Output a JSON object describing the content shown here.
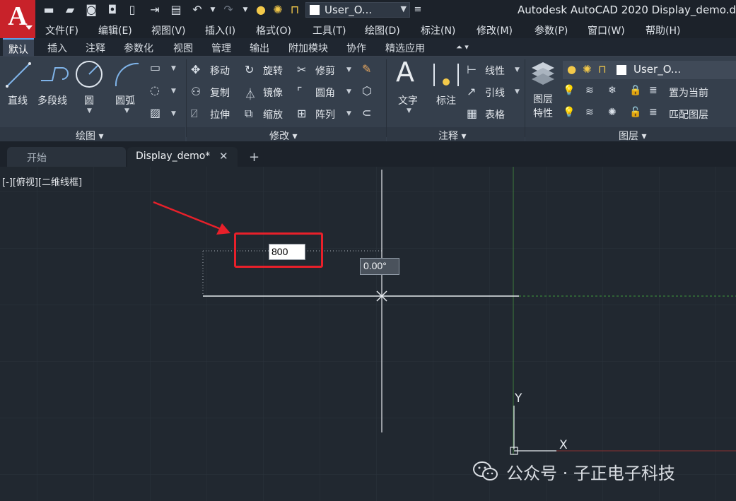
{
  "title": "Autodesk AutoCAD 2020    Display_demo.d",
  "quick_access": {
    "layer_name": "User_O..."
  },
  "menu": [
    "文件(F)",
    "编辑(E)",
    "视图(V)",
    "插入(I)",
    "格式(O)",
    "工具(T)",
    "绘图(D)",
    "标注(N)",
    "修改(M)",
    "参数(P)",
    "窗口(W)",
    "帮助(H)"
  ],
  "ribbon_tabs": [
    "默认",
    "插入",
    "注释",
    "参数化",
    "视图",
    "管理",
    "输出",
    "附加模块",
    "协作",
    "精选应用"
  ],
  "ribbon": {
    "draw": {
      "title": "绘图",
      "line": "直线",
      "polyline": "多段线",
      "circle": "圆",
      "arc": "圆弧"
    },
    "modify": {
      "title": "修改",
      "move": "移动",
      "rotate": "旋转",
      "trim": "修剪",
      "copy": "复制",
      "mirror": "镜像",
      "fillet": "圆角",
      "stretch": "拉伸",
      "scale": "缩放",
      "array": "阵列"
    },
    "annotation": {
      "title": "注释",
      "text": "文字",
      "dimension": "标注",
      "linear": "线性",
      "leader": "引线",
      "table": "表格"
    },
    "layers": {
      "title": "图层",
      "layer_properties_line1": "图层",
      "layer_properties_line2": "特性",
      "layer_name": "User_O...",
      "set_current": "置为当前",
      "match_layer": "匹配图层"
    }
  },
  "doc_tabs": {
    "start": "开始",
    "active": "Display_demo*"
  },
  "viewport": {
    "label": "[-][俯视][二维线框]",
    "distance_input": "800",
    "angle": "0.00°",
    "ucs_x": "X",
    "ucs_y": "Y"
  },
  "watermark": "公众号 · 子正电子科技",
  "colors": {
    "canvas": "#212830",
    "ribbon": "#353f4c",
    "logo": "#c8222a",
    "highlight_box": "#e8202a"
  }
}
